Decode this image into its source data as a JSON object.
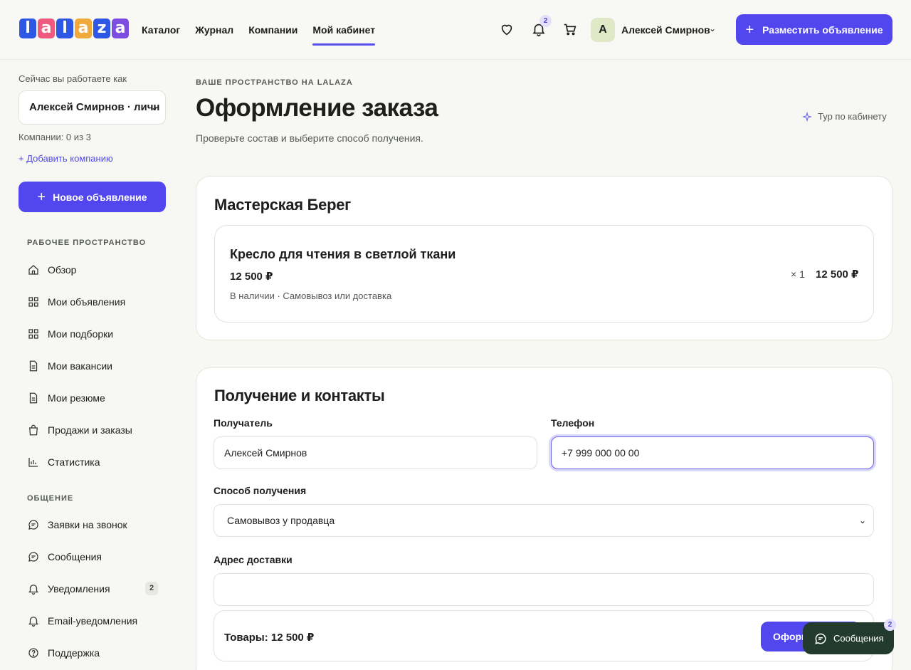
{
  "header": {
    "logo": [
      "l",
      "a",
      "l",
      "a",
      "z",
      "a"
    ],
    "logo_colors": [
      "#2f57e6",
      "#f05a7e",
      "#2f57e6",
      "#f0a93a",
      "#2f57e6",
      "#7c4de0"
    ],
    "nav": [
      {
        "label": "Каталог"
      },
      {
        "label": "Журнал"
      },
      {
        "label": "Компании"
      },
      {
        "label": "Мой кабинет",
        "active": true
      }
    ],
    "notifications_count": "2",
    "avatar_letter": "А",
    "user_name": "Алексей Смирнов",
    "post_button": "Разместить объявление"
  },
  "sidebar": {
    "working_as_label": "Сейчас вы работаете как",
    "account_selected": "Алексей Смирнов · личн",
    "companies_count": "Компании: 0 из 3",
    "add_company": "+ Добавить компанию",
    "new_ad_button": "Новое объявление",
    "workspace_title": "РАБОЧЕЕ ПРОСТРАНСТВО",
    "workspace_items": [
      {
        "label": "Обзор",
        "icon": "home-icon"
      },
      {
        "label": "Мои объявления",
        "icon": "grid-icon"
      },
      {
        "label": "Мои подборки",
        "icon": "grid-icon"
      },
      {
        "label": "Мои вакансии",
        "icon": "document-icon"
      },
      {
        "label": "Мои резюме",
        "icon": "document-icon"
      },
      {
        "label": "Продажи и заказы",
        "icon": "bag-icon"
      },
      {
        "label": "Статистика",
        "icon": "chart-icon"
      }
    ],
    "comm_title": "ОБЩЕНИЕ",
    "comm_items": [
      {
        "label": "Заявки на звонок",
        "icon": "chat-icon"
      },
      {
        "label": "Сообщения",
        "icon": "chat-icon"
      },
      {
        "label": "Уведомления",
        "icon": "bell-icon",
        "count": "2"
      },
      {
        "label": "Email-уведомления",
        "icon": "bell-icon"
      },
      {
        "label": "Поддержка",
        "icon": "help-icon"
      }
    ]
  },
  "main": {
    "kicker": "ВАШЕ ПРОСТРАНСТВО НА LALAZA",
    "title": "Оформление заказа",
    "subtitle": "Проверьте состав и выберите способ получения.",
    "tour_link": "Тур по кабинету",
    "seller": {
      "name": "Мастерская Берег",
      "item": {
        "name": "Кресло для чтения в светлой ткани",
        "price": "12 500 ₽",
        "meta": "В наличии · Самовывоз или доставка",
        "qty": "× 1",
        "total": "12 500 ₽"
      }
    },
    "delivery": {
      "title": "Получение и контакты",
      "recipient_label": "Получатель",
      "recipient_value": "Алексей Смирнов",
      "phone_label": "Телефон",
      "phone_value": "+7 999 000 00 00",
      "method_label": "Способ получения",
      "method_value": "Самовывоз у продавца",
      "address_label": "Адрес доставки",
      "address_value": ""
    },
    "summary": {
      "total": "Товары: 12 500 ₽",
      "order_button": "Оформ"
    }
  },
  "chat_widget": {
    "label": "Сообщения",
    "count": "2"
  },
  "colors": {
    "accent": "#5247ee",
    "chat_bg": "#233b2e"
  }
}
